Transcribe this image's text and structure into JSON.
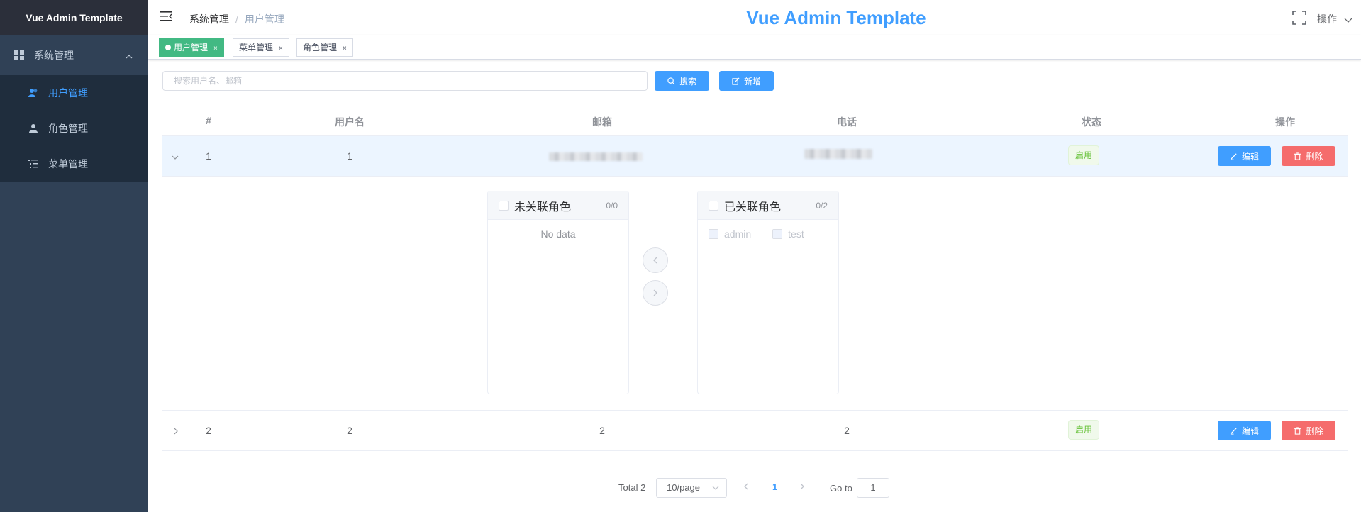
{
  "sidebar": {
    "logo": "Vue Admin Template",
    "group": {
      "label": "系统管理",
      "icon": "grid-icon"
    },
    "items": [
      {
        "label": "用户管理",
        "icon": "users-icon",
        "active": true
      },
      {
        "label": "角色管理",
        "icon": "user-icon",
        "active": false
      },
      {
        "label": "菜单管理",
        "icon": "list-icon",
        "active": false
      }
    ]
  },
  "header": {
    "breadcrumb": [
      "系统管理",
      "用户管理"
    ],
    "breadcrumb_sep": "/",
    "title": "Vue Admin Template",
    "ops_label": "操作"
  },
  "tags": [
    {
      "label": "用户管理",
      "active": true
    },
    {
      "label": "菜单管理",
      "active": false
    },
    {
      "label": "角色管理",
      "active": false
    }
  ],
  "toolbar": {
    "search_placeholder": "搜索用户名、邮箱",
    "search_label": "搜索",
    "add_label": "新增"
  },
  "table": {
    "columns": [
      "#",
      "用户名",
      "邮箱",
      "电话",
      "状态",
      "操作"
    ],
    "rows": [
      {
        "id": "1",
        "username": "1",
        "email": "",
        "phone": "",
        "status": "启用",
        "expanded": true
      },
      {
        "id": "2",
        "username": "2",
        "email": "2",
        "phone": "2",
        "status": "启用",
        "expanded": false
      }
    ],
    "edit_label": "编辑",
    "delete_label": "删除"
  },
  "transfer": {
    "left": {
      "title": "未关联角色",
      "count": "0/0",
      "empty": "No data"
    },
    "right": {
      "title": "已关联角色",
      "count": "0/2",
      "items": [
        "admin",
        "test"
      ]
    }
  },
  "pagination": {
    "total": "Total 2",
    "page_size": "10/page",
    "current": "1",
    "goto_label": "Go to",
    "goto_value": "1"
  },
  "colors": {
    "primary": "#409eff",
    "danger": "#f56c6c",
    "success": "#42b983",
    "sidebar_bg": "#304156"
  }
}
